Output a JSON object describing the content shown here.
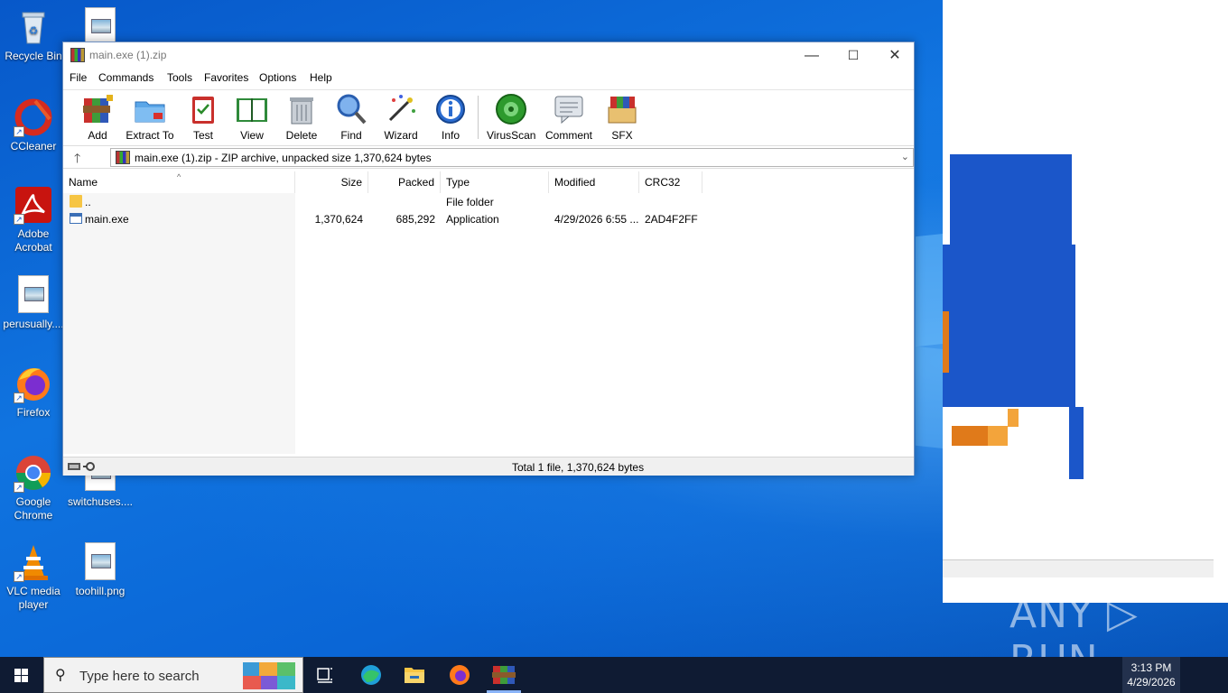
{
  "desktop": {
    "icons": [
      {
        "label": "Recycle Bin"
      },
      {
        "label": "CCleaner"
      },
      {
        "label": "Adobe Acrobat"
      },
      {
        "label": "perusually...."
      },
      {
        "label": "Firefox"
      },
      {
        "label": "Google Chrome"
      },
      {
        "label": "switchuses...."
      },
      {
        "label": "VLC media player"
      },
      {
        "label": "toohill.png"
      }
    ]
  },
  "window": {
    "title": "main.exe (1).zip",
    "minimize": "—",
    "maximize": "☐",
    "close": "✕"
  },
  "menu": [
    "File",
    "Commands",
    "Tools",
    "Favorites",
    "Options",
    "Help"
  ],
  "toolbar": [
    {
      "label": "Add",
      "icon": "add-archive-icon"
    },
    {
      "label": "Extract To",
      "icon": "extract-folder-icon"
    },
    {
      "label": "Test",
      "icon": "test-clipboard-icon"
    },
    {
      "label": "View",
      "icon": "view-book-icon"
    },
    {
      "label": "Delete",
      "icon": "trash-can-icon"
    },
    {
      "label": "Find",
      "icon": "magnifier-icon"
    },
    {
      "label": "Wizard",
      "icon": "magic-wand-icon"
    },
    {
      "label": "Info",
      "icon": "info-icon"
    },
    {
      "label": "VirusScan",
      "icon": "virus-scan-icon"
    },
    {
      "label": "Comment",
      "icon": "comment-icon"
    },
    {
      "label": "SFX",
      "icon": "sfx-archive-icon"
    }
  ],
  "address": {
    "up": "🡑",
    "path": "main.exe (1).zip - ZIP archive, unpacked size 1,370,624 bytes",
    "dropdown": "⌄"
  },
  "columns": [
    "Name",
    "Size",
    "Packed",
    "Type",
    "Modified",
    "CRC32"
  ],
  "rows": [
    {
      "name": "..",
      "size": "",
      "packed": "",
      "type": "File folder",
      "modified": "",
      "crc": ""
    },
    {
      "name": "main.exe",
      "size": "1,370,624",
      "packed": "685,292",
      "type": "Application",
      "modified": "4/29/2026 6:55 ...",
      "crc": "2AD4F2FF"
    }
  ],
  "status": {
    "text": "Total 1 file, 1,370,624 bytes"
  },
  "taskbar": {
    "search_placeholder": "Type here to search",
    "time": "3:13 PM",
    "date": "4/29/2026"
  },
  "watermark": "ANY ▷ RUN"
}
